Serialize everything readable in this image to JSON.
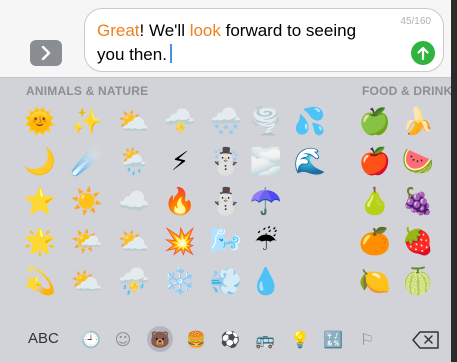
{
  "compose": {
    "message_parts": [
      {
        "text": "Great",
        "highlight": true
      },
      {
        "text": "! We'll ",
        "highlight": false
      },
      {
        "text": "look",
        "highlight": true
      },
      {
        "text": " forward to seeing you then.",
        "highlight": false
      }
    ],
    "counter": "45/160",
    "expand_icon": "chevron-right-icon",
    "send_icon": "arrow-up-icon",
    "highlight_color": "#f0801e",
    "send_color": "#2fb53f"
  },
  "sections": [
    {
      "title": "ANIMALS & NATURE"
    },
    {
      "title": "FOOD & DRINK"
    }
  ],
  "emoji_grid": {
    "nature_columns": [
      [
        "🌞",
        "🌙",
        "⭐",
        "🌟",
        "💫"
      ],
      [
        "✨",
        "☄️",
        "☀️",
        "🌤️",
        "⛅"
      ],
      [
        "⛅",
        "🌦️",
        "☁️",
        "⛅",
        "⛈️"
      ],
      [
        "🌩️",
        "⚡",
        "🔥",
        "💥",
        "❄️"
      ],
      [
        "🌨️",
        "☃️",
        "⛄",
        "🌬️",
        "💨"
      ],
      [
        "🌪️",
        "🌫️",
        "☂️",
        "☔",
        "💧"
      ],
      [
        "💦",
        "🌊",
        "",
        "",
        ""
      ]
    ],
    "food_columns": [
      [
        "🍏",
        "🍎",
        "🍐",
        "🍊",
        "🍋"
      ],
      [
        "🍌",
        "🍉",
        "🍇",
        "🍓",
        "🍈"
      ]
    ]
  },
  "bottom_bar": {
    "abc_label": "ABC",
    "categories": [
      {
        "name": "recent-icon",
        "glyph": "🕘"
      },
      {
        "name": "smileys-icon",
        "glyph": "☺"
      },
      {
        "name": "animals-icon",
        "glyph": "🐻",
        "active": true
      },
      {
        "name": "food-icon",
        "glyph": "🍔"
      },
      {
        "name": "activity-icon",
        "glyph": "⚽"
      },
      {
        "name": "travel-icon",
        "glyph": "🚌"
      },
      {
        "name": "objects-icon",
        "glyph": "💡"
      },
      {
        "name": "symbols-icon",
        "glyph": "🔣"
      },
      {
        "name": "flags-icon",
        "glyph": "⚐"
      }
    ],
    "delete_icon": "backspace-icon"
  }
}
